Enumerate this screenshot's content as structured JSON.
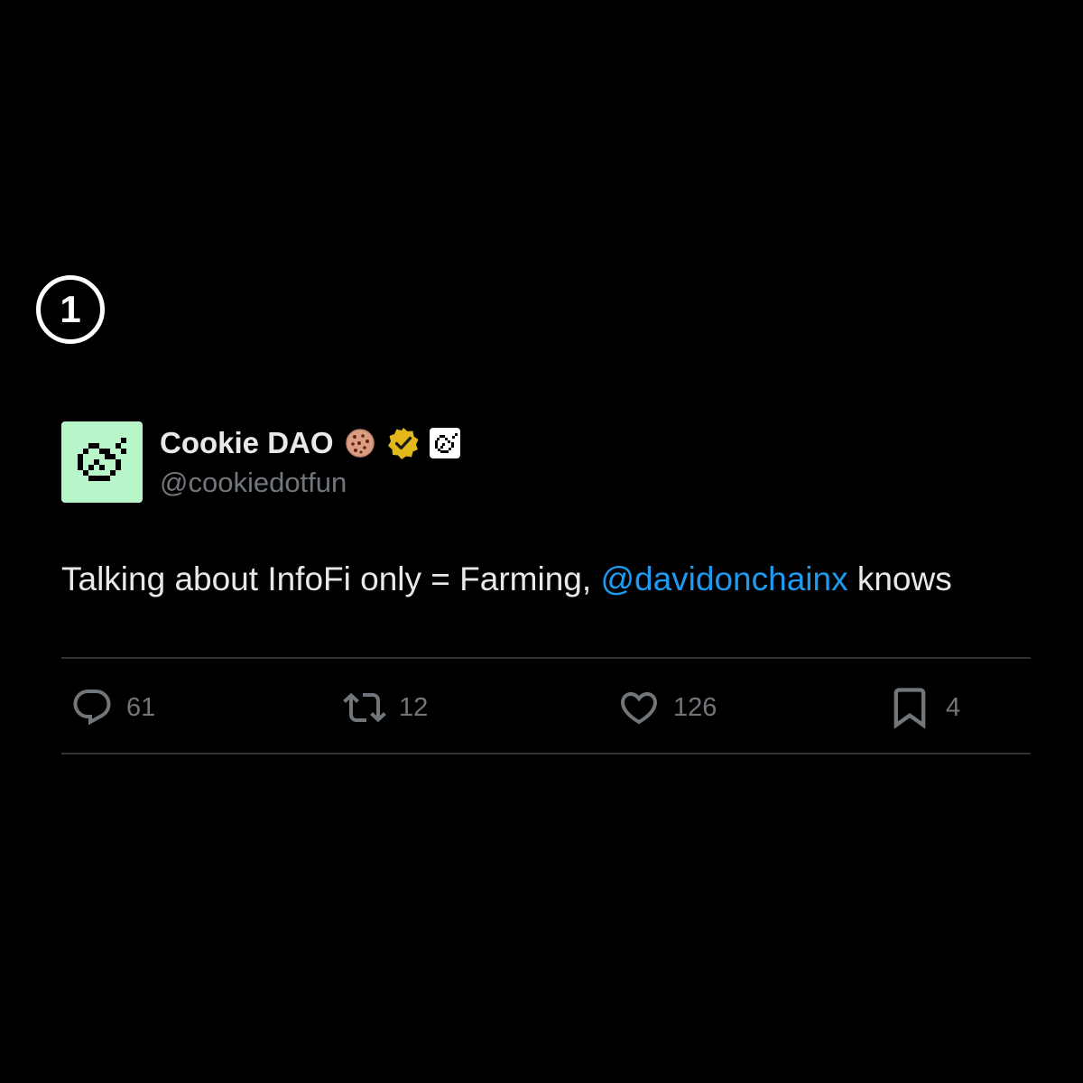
{
  "step_badge": "1",
  "tweet": {
    "author": {
      "display_name": "Cookie DAO",
      "handle": "@cookiedotfun",
      "avatar_icon": "pixel-cookie-icon",
      "avatar_bg": "#b8f5c9",
      "badges": [
        "cookie-emoji-icon",
        "gold-verified-badge-icon",
        "affiliate-cookie-icon"
      ]
    },
    "text_before": "Talking about InfoFi only = Farming, ",
    "mention": "@davidonchainx",
    "text_after": " knows",
    "actions": {
      "replies": "61",
      "reposts": "12",
      "likes": "126",
      "bookmarks": "4"
    }
  },
  "colors": {
    "background": "#000000",
    "text": "#e7e9ea",
    "muted": "#71767b",
    "link": "#1d9bf0",
    "verified_gold": "#e2b719",
    "divider": "#2f3336"
  }
}
